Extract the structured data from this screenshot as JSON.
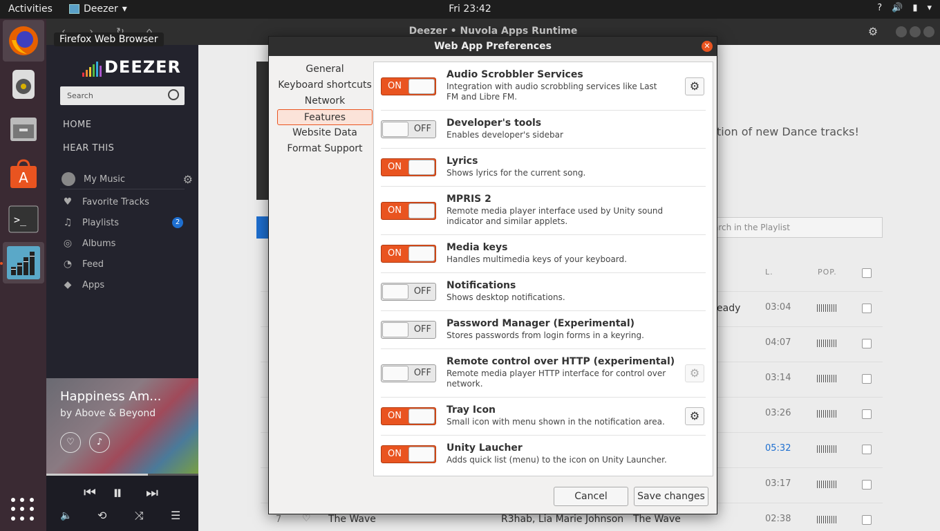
{
  "topbar": {
    "activities": "Activities",
    "app_name": "Deezer",
    "clock": "Fri 23:42"
  },
  "window": {
    "title": "Deezer • Nuvola Apps Runtime"
  },
  "tooltip": "Firefox Web Browser",
  "deezer": {
    "logo": "DEEZER",
    "search_placeholder": "Search",
    "nav": [
      "HOME",
      "HEAR THIS"
    ],
    "items": [
      {
        "label": "My Music",
        "icon": "avatar"
      },
      {
        "label": "Favorite Tracks",
        "icon": "heart-icon"
      },
      {
        "label": "Playlists",
        "icon": "playlist-icon",
        "badge": "2"
      },
      {
        "label": "Albums",
        "icon": "album-icon"
      },
      {
        "label": "Feed",
        "icon": "feed-icon"
      },
      {
        "label": "Apps",
        "icon": "apps-icon"
      }
    ],
    "player": {
      "song": "Happiness Am...",
      "artist": "by Above & Beyond",
      "progress": 0.67
    },
    "main": {
      "description": "tion of new Dance tracks!",
      "playlist_search": "arch in the Playlist",
      "col_length": "L.",
      "col_pop": "POP.",
      "ready_text": "eady",
      "times": [
        "03:04",
        "04:07",
        "03:14",
        "03:26",
        "05:32",
        "03:17",
        "02:38"
      ],
      "last_row": {
        "index": "7",
        "title": "The Wave",
        "artist": "R3hab, Lia Marie Johnson",
        "album": "The Wave"
      }
    }
  },
  "dialog": {
    "title": "Web App Preferences",
    "tabs": [
      "General",
      "Keyboard shortcuts",
      "Network",
      "Features",
      "Website Data",
      "Format Support"
    ],
    "active_tab": "Features",
    "on_label": "ON",
    "off_label": "OFF",
    "features": [
      {
        "name": "Audio Scrobbler Services",
        "desc": "Integration with audio scrobbling services like Last FM and Libre FM.",
        "state": "on",
        "gear": "enabled"
      },
      {
        "name": "Developer's tools",
        "desc": "Enables developer's sidebar",
        "state": "off",
        "gear": "none"
      },
      {
        "name": "Lyrics",
        "desc": "Shows lyrics for the current song.",
        "state": "on",
        "gear": "none"
      },
      {
        "name": "MPRIS 2",
        "desc": "Remote media player interface used by Unity sound indicator and similar applets.",
        "state": "on",
        "gear": "none"
      },
      {
        "name": "Media keys",
        "desc": "Handles multimedia keys of your keyboard.",
        "state": "on",
        "gear": "none"
      },
      {
        "name": "Notifications",
        "desc": "Shows desktop notifications.",
        "state": "off",
        "gear": "none"
      },
      {
        "name": "Password Manager (Experimental)",
        "desc": "Stores passwords from login forms in a keyring.",
        "state": "off",
        "gear": "none"
      },
      {
        "name": "Remote control over HTTP (experimental)",
        "desc": "Remote media player HTTP interface for control over network.",
        "state": "off",
        "gear": "disabled"
      },
      {
        "name": "Tray Icon",
        "desc": "Small icon with menu shown in the notification area.",
        "state": "on",
        "gear": "enabled"
      },
      {
        "name": "Unity Laucher",
        "desc": "Adds quick list (menu) to the icon on Unity Launcher.",
        "state": "on",
        "gear": "none"
      }
    ],
    "cancel": "Cancel",
    "save": "Save changes"
  },
  "colors": {
    "accent": "#e95420",
    "deezer_sidebar": "#23232d",
    "badge": "#1e6fd0"
  }
}
